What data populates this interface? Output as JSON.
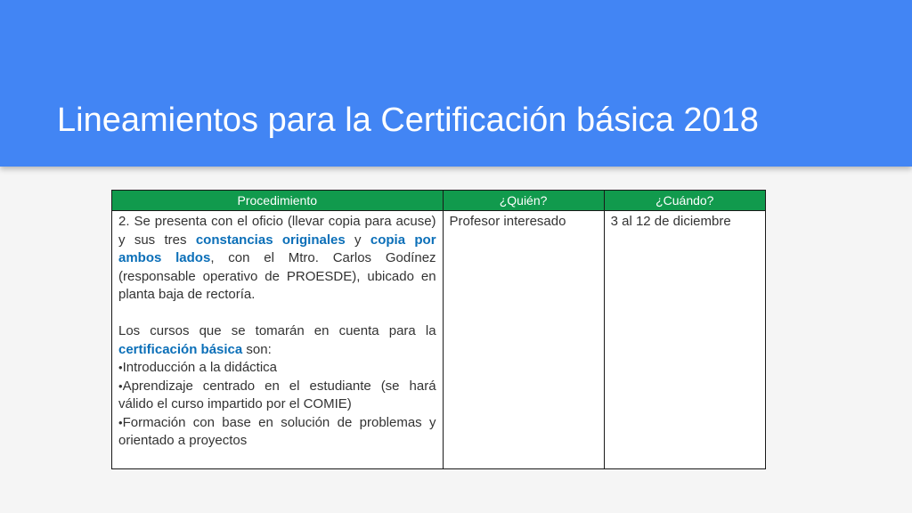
{
  "slide": {
    "title": "Lineamientos para la Certificación básica 2018"
  },
  "table": {
    "headers": {
      "procedimiento": "Procedimiento",
      "quien": "¿Quién?",
      "cuando": "¿Cuándo?"
    },
    "row": {
      "paragraph1": {
        "part1": "2. Se presenta con el oficio (llevar copia para acuse) y sus tres ",
        "highlight1": "constancias originales",
        "part2": " y ",
        "highlight2": "copia por ambos lados",
        "part3": ", con el Mtro. Carlos Godínez (responsable operativo de PROESDE), ubicado en planta baja de rectoría."
      },
      "paragraph2": {
        "part1": "Los cursos que se tomarán en cuenta para la ",
        "highlight1": "certificación básica",
        "part2": " son:"
      },
      "bullet_glyph": "•",
      "bullets": [
        "Introducción a la didáctica",
        "Aprendizaje centrado en el estudiante (se hará válido el curso impartido por el COMIE)",
        "Formación con base en solución de problemas y orientado a proyectos"
      ],
      "quien": "Profesor interesado",
      "cuando": "3 al 12 de diciembre"
    }
  },
  "colors": {
    "header_bar": "#4285f4",
    "table_header": "#119a4d",
    "highlight_text": "#0b6fb8"
  }
}
